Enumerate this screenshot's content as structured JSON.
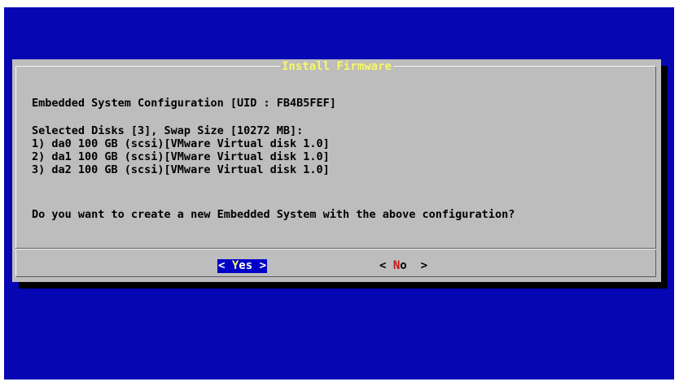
{
  "dialog": {
    "title": "Install Firmware",
    "heading": "Embedded System Configuration [UID : FB4B5FEF]",
    "disks_summary": "Selected Disks [3], Swap Size [10272 MB]:",
    "disks": [
      "1) da0 100 GB (scsi)[VMware Virtual disk 1.0]",
      "2) da1 100 GB (scsi)[VMware Virtual disk 1.0]",
      "3) da2 100 GB (scsi)[VMware Virtual disk 1.0]"
    ],
    "question": "Do you want to create a new Embedded System with the above configuration?"
  },
  "buttons": {
    "yes": {
      "open": "< ",
      "hotkey": "Y",
      "rest": "es",
      "close": " >"
    },
    "no": {
      "open": "< ",
      "hotkey": "N",
      "rest": "o",
      "close": "  >"
    }
  },
  "colors": {
    "screen_background": "#0606b3",
    "dialog_background": "#bdbdbd",
    "title": "#f7f765",
    "selected_button_bg": "#0000c8",
    "hotkey_selected": "#f7f765",
    "hotkey_unselected": "#c81414"
  }
}
